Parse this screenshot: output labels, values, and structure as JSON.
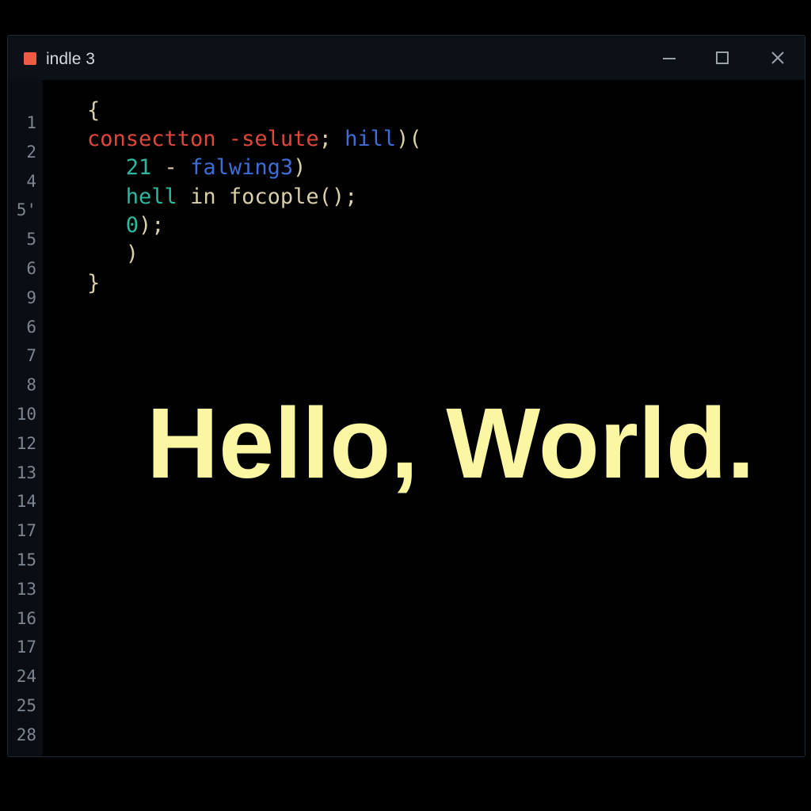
{
  "window": {
    "title": "indle 3",
    "icon": "app-icon",
    "accent_color": "#ef5a44",
    "controls": {
      "minimize_icon": "minimize-icon",
      "maximize_icon": "maximize-icon",
      "close_icon": "close-icon"
    }
  },
  "editor": {
    "line_numbers": [
      "1",
      "2",
      "4",
      "5'",
      "5",
      "6",
      "9",
      "6",
      "7",
      "8",
      "10",
      "12",
      "13",
      "14",
      "17",
      "15",
      "13",
      "16",
      "17",
      "24",
      "25",
      "28"
    ],
    "lines": [
      {
        "indent": "",
        "tokens": [
          {
            "text": "{",
            "color": "default"
          }
        ]
      },
      {
        "indent": "",
        "tokens": [
          {
            "text": "consectton -selute",
            "color": "red"
          },
          {
            "text": "; ",
            "color": "default"
          },
          {
            "text": "hill",
            "color": "blue"
          },
          {
            "text": ")(",
            "color": "default"
          }
        ]
      },
      {
        "indent": "   ",
        "tokens": [
          {
            "text": "21",
            "color": "teal"
          },
          {
            "text": " - ",
            "color": "default"
          },
          {
            "text": "falwing3",
            "color": "blue"
          },
          {
            "text": ")",
            "color": "default"
          }
        ]
      },
      {
        "indent": "   ",
        "tokens": [
          {
            "text": "hell",
            "color": "teal"
          },
          {
            "text": " in focople();",
            "color": "default"
          }
        ]
      },
      {
        "indent": "   ",
        "tokens": [
          {
            "text": "0",
            "color": "teal"
          },
          {
            "text": ");",
            "color": "default"
          }
        ]
      },
      {
        "indent": "   ",
        "tokens": [
          {
            "text": ")",
            "color": "default"
          }
        ]
      },
      {
        "indent": "",
        "tokens": [
          {
            "text": "}",
            "color": "default"
          }
        ]
      }
    ],
    "overlay_text": "Hello, World.",
    "colors": {
      "red": "#e0473c",
      "blue": "#3d6ed8",
      "teal": "#2fb8a0",
      "default": "#d8cfa8",
      "overlay": "#fbf6a2"
    }
  }
}
